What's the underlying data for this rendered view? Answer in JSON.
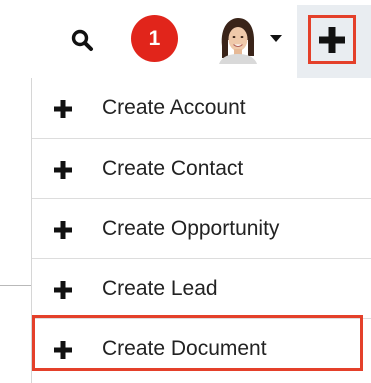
{
  "header": {
    "search_icon": "search-icon",
    "notifications": {
      "count": "1",
      "color": "#e1251b"
    },
    "user_menu": {
      "avatar": "avatar",
      "caret_icon": "caret-down-icon"
    },
    "quick_create": {
      "icon": "plus-icon",
      "background": "#e9edf1",
      "highlight_color": "#e4402a"
    }
  },
  "dropdown": {
    "items": [
      {
        "label": "Create Account",
        "icon": "plus-icon"
      },
      {
        "label": "Create Contact",
        "icon": "plus-icon"
      },
      {
        "label": "Create Opportunity",
        "icon": "plus-icon"
      },
      {
        "label": "Create Lead",
        "icon": "plus-icon"
      },
      {
        "label": "Create Document",
        "icon": "plus-icon",
        "highlighted": true
      }
    ]
  }
}
